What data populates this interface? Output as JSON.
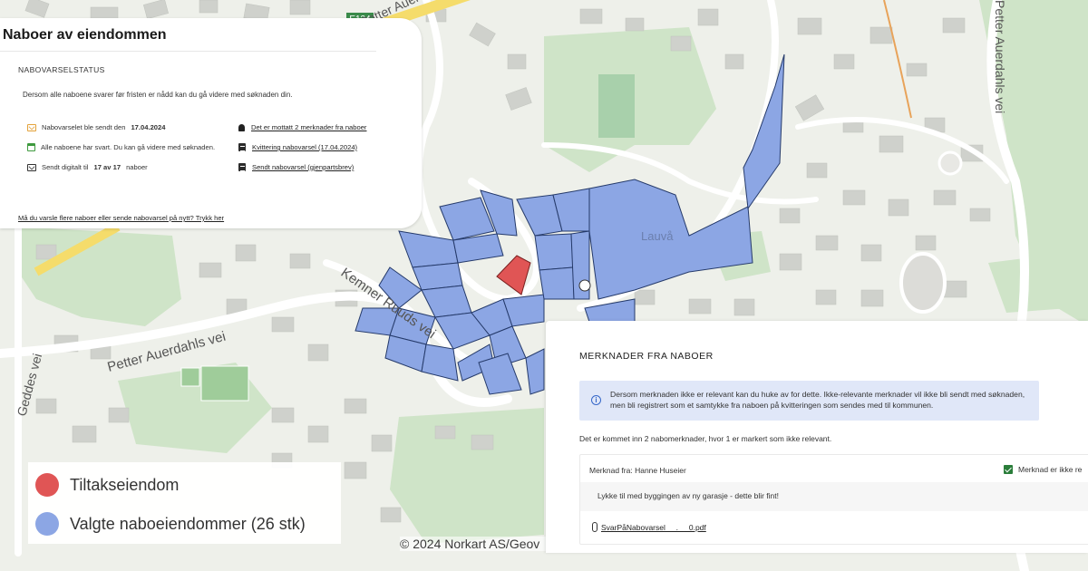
{
  "map": {
    "road_e134": "E134",
    "road_petter_auerdahls_vei_top": "Petter Auerdahls vei",
    "road_petter_auerdahls_vei_right": "Petter Auerdahls vei",
    "road_petter_auerdahls_vei_left": "Petter Auerdahls vei",
    "road_kemner_ruuds_vei": "Kemner Ruuds vei",
    "road_geddes_vei": "Geddes vei",
    "place_lauva": "Lauvå",
    "colors": {
      "tiltakseiendom": "#e05555",
      "naboeiendom": "#8ca6e4"
    }
  },
  "neighbours_panel": {
    "title": "Naboer av eiendommen",
    "status_heading": "NABOVARSELSTATUS",
    "intro": "Dersom alle naboene svarer før fristen er nådd kan du gå videre med søknaden din.",
    "left_rows": [
      {
        "icon": "envelope-icon",
        "text": "Nabovarselet ble sendt den",
        "bold": "17.04.2024",
        "suffix": ""
      },
      {
        "icon": "calendar-icon",
        "text": "Alle naboene har svart. Du kan gå videre med søknaden.",
        "bold": "",
        "suffix": ""
      },
      {
        "icon": "envelope-icon",
        "text": "Sendt digitalt til",
        "bold": "17 av 17",
        "suffix": "naboer"
      }
    ],
    "right_links": [
      {
        "icon": "bell-icon",
        "text": "Det er mottatt 2 merknader fra naboer"
      },
      {
        "icon": "document-icon",
        "text": "Kvittering nabovarsel (17.04.2024)"
      },
      {
        "icon": "document-icon",
        "text": "Sendt nabovarsel (gjenpartsbrev)"
      }
    ],
    "resend_link": "Må du varsle flere naboer eller sende nabovarsel på nytt? Trykk her"
  },
  "legend": {
    "items": [
      {
        "label": "Tiltakseiendom",
        "color": "#e05555"
      },
      {
        "label": "Valgte naboeiendommer (26 stk)",
        "color": "#8ca6e4"
      }
    ]
  },
  "attribution": "© 2024 Norkart AS/Geov",
  "comments_panel": {
    "title": "MERKNADER FRA NABOER",
    "info_icon": "info-icon",
    "info_text": "Dersom merknaden ikke er relevant kan du huke av for dette. Ikke-relevante merknader vil ikke bli sendt med søknaden, men bli registrert som et samtykke fra naboen på kvitteringen som sendes med til kommunen.",
    "summary": "Det er kommet inn 2 nabomerknader, hvor 1 er markert som ikke relevant.",
    "comment": {
      "from": "Merknad fra: Hanne Huseier",
      "checkbox_label": "Merknad er ikke re",
      "checked": true,
      "text": "Lykke til med byggingen av ny garasje - dette blir fint!",
      "attachment": "SvarPåNabovarsel_ _._ _0.pdf"
    }
  }
}
